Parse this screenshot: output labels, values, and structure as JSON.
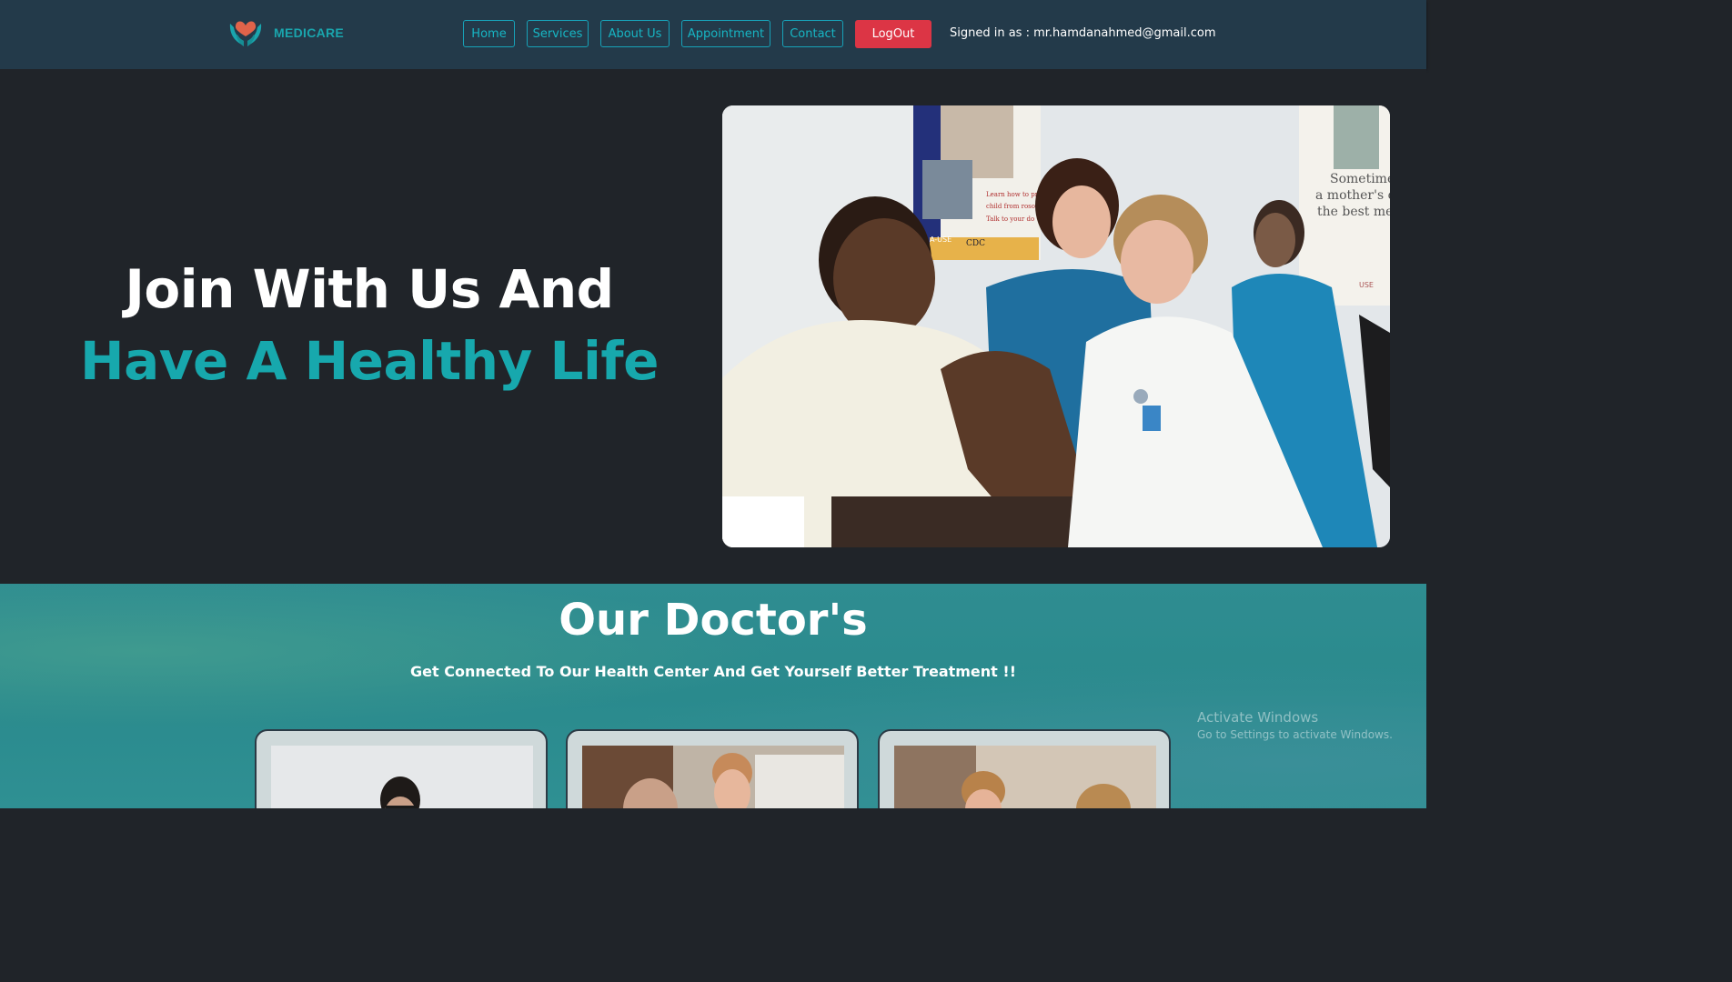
{
  "navbar": {
    "brand": "MEDICARE",
    "links": [
      "Home",
      "Services",
      "About Us",
      "Appointment",
      "Contact"
    ],
    "logout_label": "LogOut",
    "signed_in_text": "Signed in as : mr.hamdanahmed@gmail.com",
    "accent_color": "#17a2b8",
    "logout_color": "#dc3545",
    "logo_icon": "heart-hands-icon"
  },
  "hero": {
    "line1": "Join With Us And",
    "line2": "Have A Healthy Life",
    "line2_color": "#17a8ad",
    "photo": {
      "poster_texts": [
        "CDC",
        "Learn how to prot",
        "child from roso",
        "Talk to your do",
        "A-USE"
      ],
      "poster_right": [
        "Sometimes,",
        "a mother's car",
        "the best medic",
        "USE"
      ]
    }
  },
  "doctors": {
    "title": "Our Doctor's",
    "subtitle": "Get Connected To Our Health Center And Get Yourself Better Treatment !!"
  },
  "watermark": {
    "line1": "Activate Windows",
    "line2": "Go to Settings to activate Windows."
  }
}
